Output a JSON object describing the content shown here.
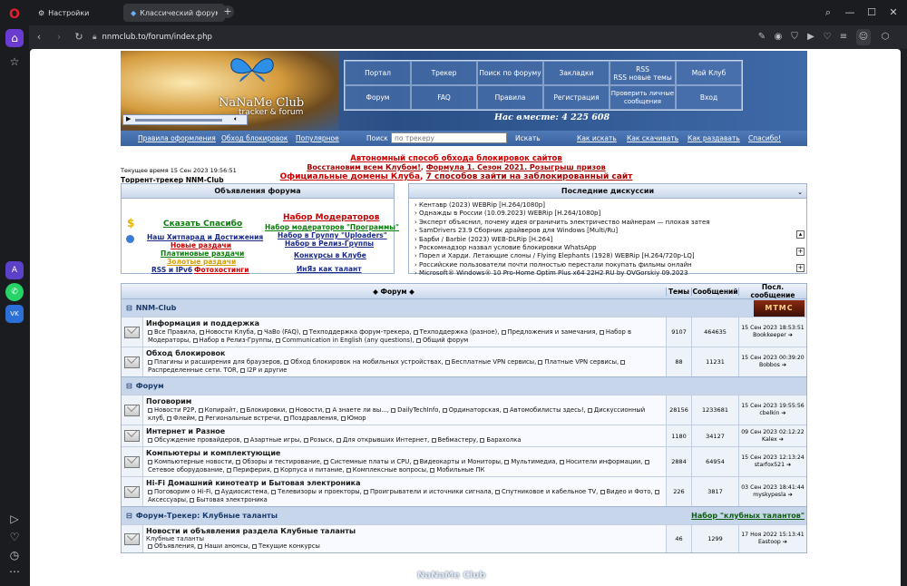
{
  "browser": {
    "tabs": [
      {
        "label": "Настройки"
      },
      {
        "label": "Классический форум-тр"
      }
    ],
    "url": "nnmclub.to/forum/index.php"
  },
  "site": {
    "logo_title": "NaNaMe Club",
    "logo_sub": "tracker & forum",
    "nav": [
      [
        "Портал",
        "Трекер",
        "Поиск по форуму",
        "Закладки",
        "RSS\nRSS новые темы",
        "Мой Клуб"
      ],
      [
        "Форум",
        "FAQ",
        "Правила",
        "Регистрация",
        "Проверить личные сообщения",
        "Вход"
      ]
    ],
    "together": "Нас вместе: 4 225 608",
    "searchbar": {
      "links_left": [
        "Правила оформления",
        "Обход блокировок",
        "Популярное"
      ],
      "search_label": "Поиск :",
      "search_placeholder": "по трекеру",
      "search_button": "Искать",
      "links_right": [
        "Как искать",
        "Как скачивать",
        "Как раздавать",
        "Спасибо!"
      ]
    },
    "time": "Текущее время 15 Сен 2023 19:56:51",
    "tracker_name": "Торрент-трекер NNM-Club",
    "promo": {
      "line1": "Автономный способ обхода блокировок сайтов",
      "line2a": "Восстановим всем Клубом!",
      "line2b": "Формула 1. Сезон 2021. Розыгрыш призов",
      "line3a": "Официальные домены Клуба",
      "line3b": "7 способов зайти на заблокированный сайт"
    }
  },
  "announce": {
    "title": "Объявления форума",
    "items": [
      "Сказать Спасибо",
      "Наш Хитпарад и Достижения",
      "Новые раздачи",
      "Платиновые раздачи",
      "Золотые раздачи",
      "RSS и IPv6",
      "Фотохостинги",
      "Набор Модераторов",
      "Набор модераторов \"Программы\"",
      "Набор в Группу \"Uploaders\"",
      "Набор в Релиз-Группы",
      "Конкурсы в Клубе",
      "ИнЯз как талант"
    ]
  },
  "recent": {
    "title": "Последние дискуссии",
    "items": [
      "Кентавр (2023) WEBRip [H.264/1080p]",
      "Однажды в России (10.09.2023) WEBRip [H.264/1080p]",
      "Эксперт объяснил, почему идея ограничить электричество майнерам — плохая затея",
      "SamDrivers 23.9 Сборник драйверов для Windows [Multi/Ru]",
      "Барби / Barbie (2023) WEB-DLRip [H.264]",
      "Роскомнадзор назвал условие блокировки WhatsApp",
      "Порел и Харди. Летающие слоны / Flying Elephants (1928) WEBRip [H.264/720p-LQ]",
      "Российские пользователи почти полностью перестали покупать фильмы онлайн",
      "Microsoft® Windows® 10 Pro-Home Optim Plus x64 22H2 RU by OVGorskiy 09.2023"
    ]
  },
  "forum": {
    "headers": {
      "forum": "Форум",
      "topics": "Темы",
      "posts": "Сообщений",
      "last": "Посл. сообщение"
    },
    "cats": [
      {
        "name": "NNM-Club",
        "badge": "МТМС",
        "rows": [
          {
            "title": "Информация и поддержка",
            "sub": "Все Правила, Новости Клуба, ЧаВо (FAQ), Техподдержка форум-трекера, Техподдержка (разное), Предложения и замечания, Набор в Модераторы, Набор в Релиз-Группы, Communication in English (any questions), Общий форум",
            "t": "9107",
            "p": "464635",
            "d": "15 Сен 2023 18:53:51",
            "u": "Bookkeeper"
          },
          {
            "title": "Обход блокировок",
            "sub": "Плагины и расширения для браузеров, Обход блокировок на мобильных устройствах, Бесплатные VPN сервисы, Платные VPN сервисы, Распределенные сети. TOR, I2P и другие",
            "t": "88",
            "p": "11231",
            "d": "15 Сен 2023 00:39:20",
            "u": "Bobbos"
          }
        ]
      },
      {
        "name": "Форум",
        "rows": [
          {
            "title": "Поговорим",
            "sub": "Новости P2P, Копирайт, Блокировки, Новости, А знаете ли вы..., DailyTechInfo, Ординаторская, Автомобилисты здесь!, Дискуссионный клуб, Флейм, Региональные встречи, Поздравления, Юмор",
            "t": "28156",
            "p": "1233681",
            "d": "15 Сен 2023 19:55:56",
            "u": "cbelkin"
          },
          {
            "title": "Интернет и Разное",
            "sub": "Обсуждение провайдеров, Азартные игры, Розыск, Для открывших Интернет, Вебмастеру, Барахолка",
            "t": "1180",
            "p": "34127",
            "d": "09 Сен 2023 02:12:22",
            "u": "Kalex"
          },
          {
            "title": "Компьютеры и комплектующие",
            "sub": "Компьютерные новости, Обзоры и тестирование, Системные платы и CPU, Видеокарты и Мониторы, Мультимедиа, Носители информации, Сетевое оборудование, Периферия, Корпуса и питание, Комплексные вопросы, Мобильные ПК",
            "t": "2884",
            "p": "64954",
            "d": "15 Сен 2023 12:13:24",
            "u": "starfox521"
          },
          {
            "title": "Hi-Fi Домашний кинотеатр и Бытовая электроника",
            "sub": "Поговорим о Hi-Fi, Аудиосистема, Телевизоры и проекторы, Проигрыватели и источники сигнала, Спутниковое и кабельное TV, Видео и Фото, Аксессуары, Бытовая электроника",
            "t": "226",
            "p": "3817",
            "d": "03 Сен 2023 18:41:44",
            "u": "myskypesla"
          }
        ]
      },
      {
        "name": "Форум-Трекер: Клубные таланты",
        "link": "Набор \"клубных талантов\"",
        "rows": [
          {
            "title": "Новости и объявления раздела Клубные таланты",
            "pre": "Клубные таланты",
            "sub": "Объявления, Наши анонсы, Текущие конкурсы",
            "t": "46",
            "p": "1299",
            "d": "17 Ноя 2022 15:13:41",
            "u": "Eastoop"
          }
        ]
      }
    ]
  },
  "watermark": "NaNaMe Club"
}
